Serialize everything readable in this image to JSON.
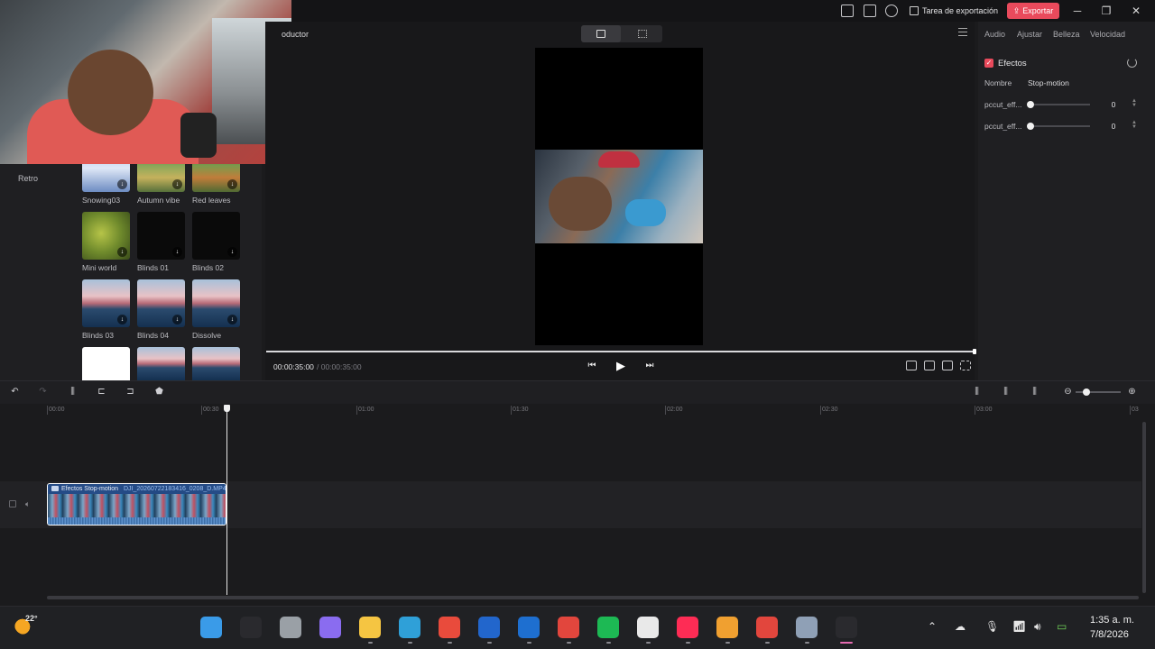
{
  "titlebar": {
    "export_task_label": "Tarea de exportación",
    "export_label": "Exportar",
    "minimize": "─",
    "restore": "❐",
    "close": "✕"
  },
  "left_panel": {
    "category": "Retro",
    "effects": [
      {
        "label": "Snowing03"
      },
      {
        "label": "Autumn vibe"
      },
      {
        "label": "Red leaves"
      },
      {
        "label": "Mini world"
      },
      {
        "label": "Blinds 01"
      },
      {
        "label": "Blinds 02"
      },
      {
        "label": "Blinds 03"
      },
      {
        "label": "Blinds 04"
      },
      {
        "label": "Dissolve"
      }
    ],
    "download_glyph": "↓"
  },
  "preview": {
    "panel_title": "oductor",
    "time_current": "00:00:35:00",
    "time_total": "/ 00:00:35:00",
    "prev_glyph": "⏮",
    "play_glyph": "▶",
    "next_glyph": "⏭",
    "progress_fraction": 1.0
  },
  "right_panel": {
    "tabs": [
      "Audio",
      "Ajustar",
      "Belleza",
      "Velocidad"
    ],
    "section_title": "Efectos",
    "section_checked": true,
    "name_label": "Nombre",
    "name_value": "Stop-motion",
    "params": [
      {
        "label": "pccut_eff...",
        "value": "0"
      },
      {
        "label": "pccut_eff...",
        "value": "0"
      }
    ]
  },
  "timeline": {
    "ruler": [
      "00:00",
      "00:30",
      "01:00",
      "01:30",
      "02:00",
      "02:30",
      "03:00",
      "03"
    ],
    "clip_effect_label": "Efectos Stop-motion",
    "clip_file_label": "DJI_20260722183416_0208_D.MP4",
    "playhead_time": "00:35",
    "toolbar_glyphs": {
      "undo": "↶",
      "redo": "↷",
      "split": "⫼",
      "trim_left": "⊏",
      "trim_right": "⊐",
      "marker": "⬟",
      "zoom_out": "⊖",
      "zoom_in": "⊕"
    }
  },
  "taskbar": {
    "weather_temp": "22°",
    "apps": [
      {
        "name": "windows-start",
        "color": "#3a9be8"
      },
      {
        "name": "search",
        "color": "#2a2a2e"
      },
      {
        "name": "task-view",
        "color": "#9aa0a6"
      },
      {
        "name": "copilot",
        "color": "#8a6cf0"
      },
      {
        "name": "file-explorer",
        "color": "#f5c542"
      },
      {
        "name": "edge",
        "color": "#2fa0d8"
      },
      {
        "name": "microsoft-store",
        "color": "#e94b3c"
      },
      {
        "name": "app-blue",
        "color": "#2266cc"
      },
      {
        "name": "outlook",
        "color": "#1e6fd0"
      },
      {
        "name": "chrome",
        "color": "#e2463d"
      },
      {
        "name": "spotify",
        "color": "#1db954"
      },
      {
        "name": "notepad",
        "color": "#e9e9e9"
      },
      {
        "name": "tiktok",
        "color": "#fe2c55"
      },
      {
        "name": "app-orange",
        "color": "#f0a030"
      },
      {
        "name": "chrome-profile",
        "color": "#e2463d"
      },
      {
        "name": "settings",
        "color": "#8fa0b6"
      },
      {
        "name": "dji-studio",
        "color": "#2a2a2e"
      }
    ],
    "clock_time": "1:35 a. m.",
    "clock_date": "7/8/2026"
  }
}
